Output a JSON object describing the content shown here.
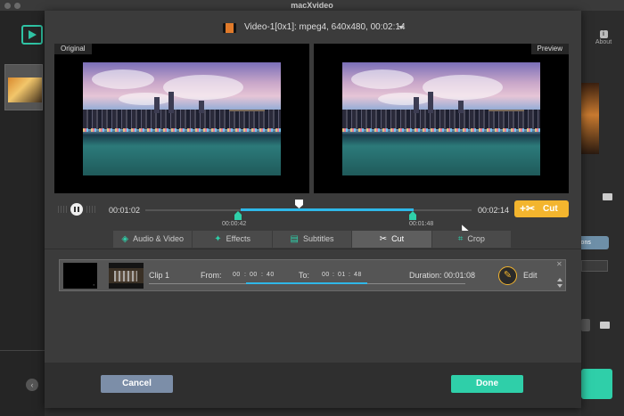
{
  "window": {
    "title": "macXvideo"
  },
  "background": {
    "about_label": "About",
    "options_label": "ions"
  },
  "source": {
    "text": "Video-1[0x1]: mpeg4, 640x480, 00:02:14"
  },
  "preview": {
    "original_label": "Original",
    "preview_label": "Preview"
  },
  "timeline": {
    "current_time": "00:01:02",
    "end_time": "00:02:14",
    "start_marker": "00:00:42",
    "end_marker": "00:01:48",
    "cut_label": "Cut"
  },
  "tabs": [
    {
      "label": "Audio & Video",
      "icon": "audio-video-icon"
    },
    {
      "label": "Effects",
      "icon": "effects-wand-icon"
    },
    {
      "label": "Subtitles",
      "icon": "subtitles-icon"
    },
    {
      "label": "Cut",
      "icon": "scissors-icon",
      "active": true
    },
    {
      "label": "Crop",
      "icon": "crop-icon"
    }
  ],
  "clip": {
    "name": "Clip 1",
    "from_label": "From:",
    "from": {
      "h": "00",
      "m": "00",
      "s": "40"
    },
    "to_label": "To:",
    "to": {
      "h": "00",
      "m": "01",
      "s": "48"
    },
    "duration": "Duration: 00:01:08",
    "edit_label": "Edit",
    "close_glyph": "✕"
  },
  "footer": {
    "cancel_label": "Cancel",
    "done_label": "Done"
  },
  "colors": {
    "accent_green": "#2fcfa9",
    "accent_yellow": "#f3b52e",
    "track_blue": "#2fb8e8",
    "cancel_blue": "#7c8ea8"
  }
}
